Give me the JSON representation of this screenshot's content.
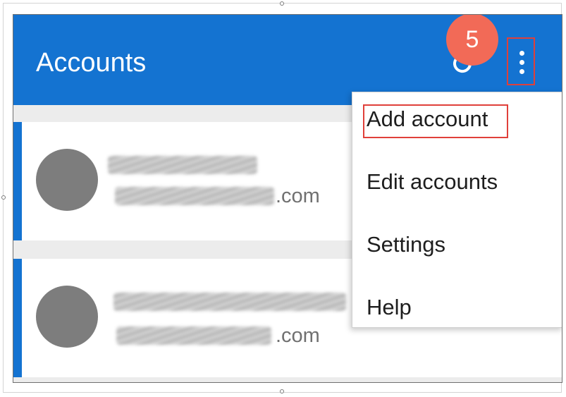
{
  "header": {
    "title": "Accounts",
    "refresh_icon": "refresh-icon",
    "more_icon": "more-vertical-icon"
  },
  "annotation": {
    "step": "5"
  },
  "accounts": [
    {
      "email_suffix": ".com"
    },
    {
      "email_suffix": ".com"
    }
  ],
  "menu": {
    "items": [
      {
        "label": "Add account"
      },
      {
        "label": "Edit accounts"
      },
      {
        "label": "Settings"
      },
      {
        "label": "Help"
      }
    ]
  },
  "colors": {
    "header_bg": "#1473d1",
    "highlight": "#e0403a",
    "step_badge": "#f26a57",
    "avatar": "#7d7d7d"
  }
}
